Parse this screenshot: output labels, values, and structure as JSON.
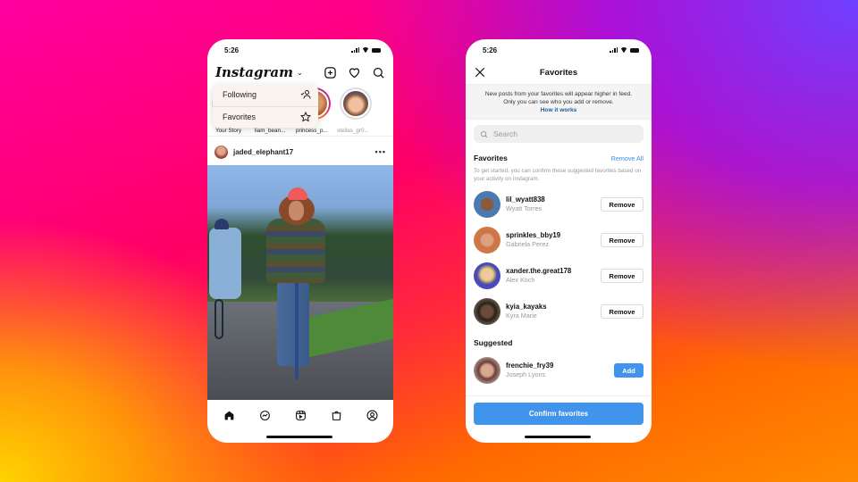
{
  "colors": {
    "accent_blue": "#4194ec",
    "link_blue": "#3b8fe8",
    "how_it_works": "#1e5a9a"
  },
  "phone_feed": {
    "status": {
      "time": "5:26"
    },
    "header": {
      "logo": "Instagram",
      "icons": [
        "add-post-icon",
        "heart-icon",
        "search-icon"
      ]
    },
    "dropdown": {
      "items": [
        {
          "label": "Following",
          "icon": "following-icon"
        },
        {
          "label": "Favorites",
          "icon": "star-icon"
        }
      ]
    },
    "stories": [
      {
        "label": "Your Story",
        "color": "#e8b48a"
      },
      {
        "label": "liam_bean...",
        "color": "#caa27a"
      },
      {
        "label": "princess_p...",
        "color": "#d28a5a"
      },
      {
        "label": "stellas_gr0...",
        "color": "#b88a70"
      }
    ],
    "post": {
      "username": "jaded_elephant17",
      "more": "•••"
    },
    "bottom_nav": [
      "home-icon",
      "messenger-icon",
      "reels-icon",
      "shop-icon",
      "profile-icon"
    ]
  },
  "phone_favorites": {
    "status": {
      "time": "5:26"
    },
    "header": {
      "title": "Favorites"
    },
    "notice": {
      "line1": "New posts from your favorites will appear higher in feed.",
      "line2": "Only you can see who you add or remove.",
      "link": "How it works"
    },
    "search": {
      "placeholder": "Search"
    },
    "favorites_section": {
      "title": "Favorites",
      "action": "Remove All",
      "hint": "To get started, you can confirm these suggested favorites based on your activity on Instagram.",
      "users": [
        {
          "username": "lil_wyatt838",
          "name": "Wyatt Torres",
          "button": "Remove",
          "color": "#4a7ab0"
        },
        {
          "username": "sprinkles_bby19",
          "name": "Gabriela Perez",
          "button": "Remove",
          "color": "#c8764a"
        },
        {
          "username": "xander.the.great178",
          "name": "Alex Koch",
          "button": "Remove",
          "color": "#4a4ab8"
        },
        {
          "username": "kyia_kayaks",
          "name": "Kyra Marie",
          "button": "Remove",
          "color": "#5a4a3a"
        }
      ]
    },
    "suggested_section": {
      "title": "Suggested",
      "users": [
        {
          "username": "frenchie_fry39",
          "name": "Joseph Lyons",
          "button": "Add",
          "color": "#b0808a"
        }
      ]
    },
    "confirm_button": "Confirm favorites"
  }
}
